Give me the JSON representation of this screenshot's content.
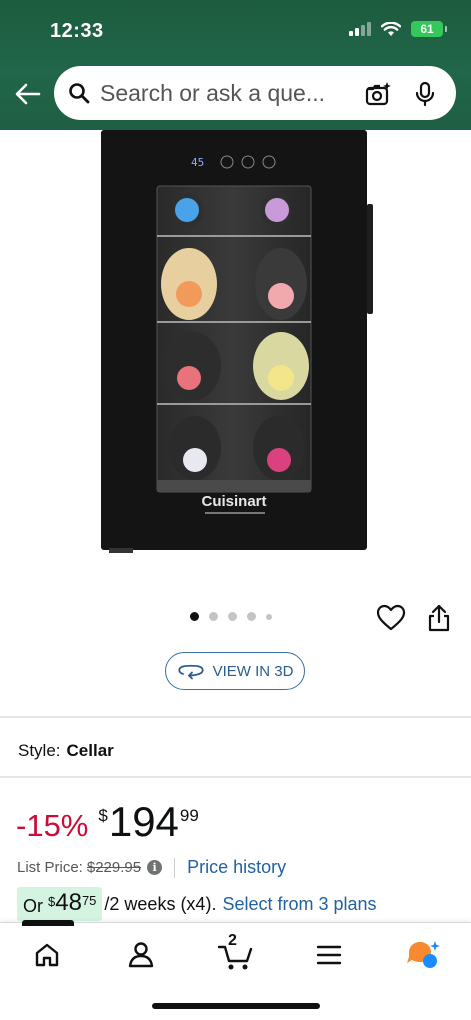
{
  "status_bar": {
    "time": "12:33",
    "battery": "61"
  },
  "search": {
    "placeholder": "Search or ask a que..."
  },
  "product": {
    "brand_label": "Cuisinart",
    "display_temp": "45",
    "carousel": {
      "total": 5,
      "active_index": 0
    }
  },
  "view_3d": {
    "label": "VIEW IN 3D"
  },
  "style": {
    "label": "Style:",
    "value": "Cellar"
  },
  "price": {
    "discount": "-15%",
    "currency": "$",
    "whole": "194",
    "fraction": "99",
    "list_price_label": "List Price:",
    "list_price": "$229.95",
    "history_link": "Price history"
  },
  "installment": {
    "prefix": "Or",
    "currency": "$",
    "whole": "48",
    "fraction": "75",
    "text": "/2 weeks (x4).",
    "link": "Select from 3 plans"
  },
  "nav": {
    "cart_count": "2"
  },
  "colors": {
    "header_green": "#1f5f43",
    "link_blue": "#2162a1",
    "discount_red": "#cc0c39",
    "installment_bg": "#d5f3e1",
    "rufus_orange": "#f7892f",
    "rufus_blue": "#1a8cff"
  }
}
